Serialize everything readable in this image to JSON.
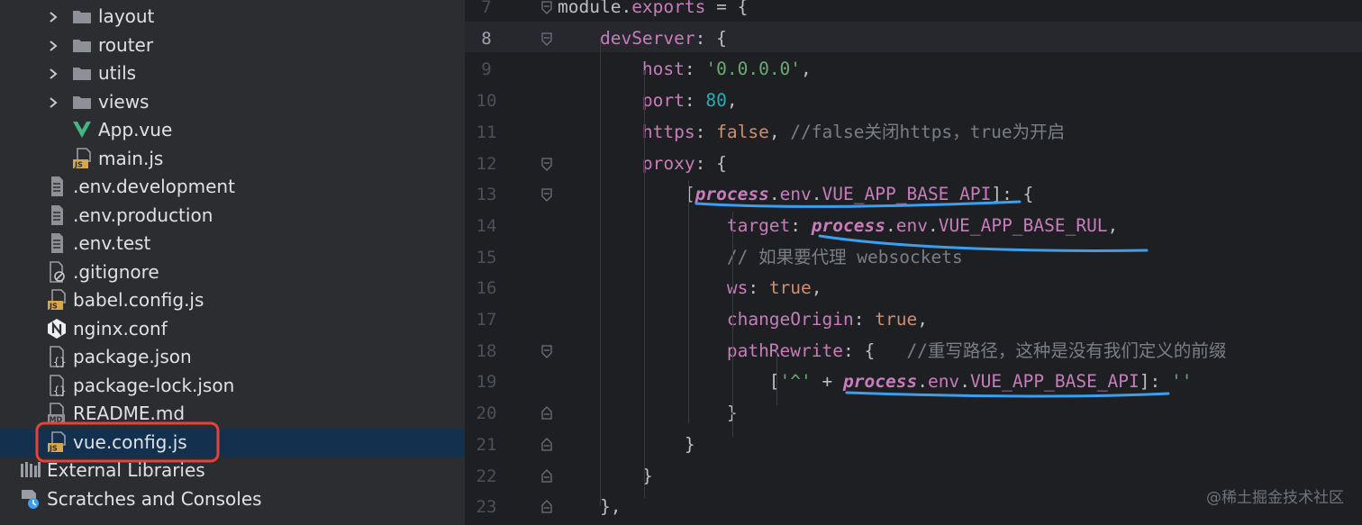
{
  "project_tree": {
    "items": [
      {
        "label": "layout",
        "icon": "folder-icon",
        "expandable": true
      },
      {
        "label": "router",
        "icon": "folder-icon",
        "expandable": true
      },
      {
        "label": "utils",
        "icon": "folder-icon",
        "expandable": true
      },
      {
        "label": "views",
        "icon": "folder-icon",
        "expandable": true
      },
      {
        "label": "App.vue",
        "icon": "vue-file-icon",
        "expandable": false
      },
      {
        "label": "main.js",
        "icon": "js-file-icon",
        "expandable": false
      },
      {
        "label": ".env.development",
        "icon": "text-file-icon",
        "expandable": false
      },
      {
        "label": ".env.production",
        "icon": "text-file-icon",
        "expandable": false
      },
      {
        "label": ".env.test",
        "icon": "text-file-icon",
        "expandable": false
      },
      {
        "label": ".gitignore",
        "icon": "ignore-file-icon",
        "expandable": false
      },
      {
        "label": "babel.config.js",
        "icon": "js-file-icon",
        "expandable": false
      },
      {
        "label": "nginx.conf",
        "icon": "nginx-file-icon",
        "expandable": false
      },
      {
        "label": "package.json",
        "icon": "json-file-icon",
        "expandable": false
      },
      {
        "label": "package-lock.json",
        "icon": "json-file-icon",
        "expandable": false
      },
      {
        "label": "README.md",
        "icon": "markdown-file-icon",
        "expandable": false
      },
      {
        "label": "vue.config.js",
        "icon": "js-file-icon",
        "expandable": false,
        "selected": true
      },
      {
        "label": "External Libraries",
        "icon": "libraries-icon",
        "expandable": false
      },
      {
        "label": "Scratches and Consoles",
        "icon": "scratches-icon",
        "expandable": false
      }
    ]
  },
  "editor": {
    "current_line": "8",
    "lines": [
      {
        "n": "7",
        "text": "module.exports = {"
      },
      {
        "n": "8",
        "text": "    devServer: {"
      },
      {
        "n": "9",
        "text": "        host: '0.0.0.0',"
      },
      {
        "n": "10",
        "text": "        port: 80,"
      },
      {
        "n": "11",
        "text": "        https: false, //false关闭https，true为开启"
      },
      {
        "n": "12",
        "text": "        proxy: {"
      },
      {
        "n": "13",
        "text": "            [process.env.VUE_APP_BASE_API]: {"
      },
      {
        "n": "14",
        "text": "                target: process.env.VUE_APP_BASE_RUL,"
      },
      {
        "n": "15",
        "text": "                // 如果要代理 websockets"
      },
      {
        "n": "16",
        "text": "                ws: true,"
      },
      {
        "n": "17",
        "text": "                changeOrigin: true,"
      },
      {
        "n": "18",
        "text": "                pathRewrite: {   //重写路径，这种是没有我们定义的前缀"
      },
      {
        "n": "19",
        "text": "                    ['^' + process.env.VUE_APP_BASE_API]: ''"
      },
      {
        "n": "20",
        "text": "                }"
      },
      {
        "n": "21",
        "text": "            }"
      },
      {
        "n": "22",
        "text": "        }"
      },
      {
        "n": "23",
        "text": "    },"
      }
    ]
  },
  "watermark": "@稀土掘金技术社区",
  "colors": {
    "sidebar_bg": "#2b2d30",
    "editor_bg": "#1e1f22",
    "selection": "#13314e",
    "annotation_red": "#e0443e",
    "annotation_blue": "#3a9ff0"
  }
}
